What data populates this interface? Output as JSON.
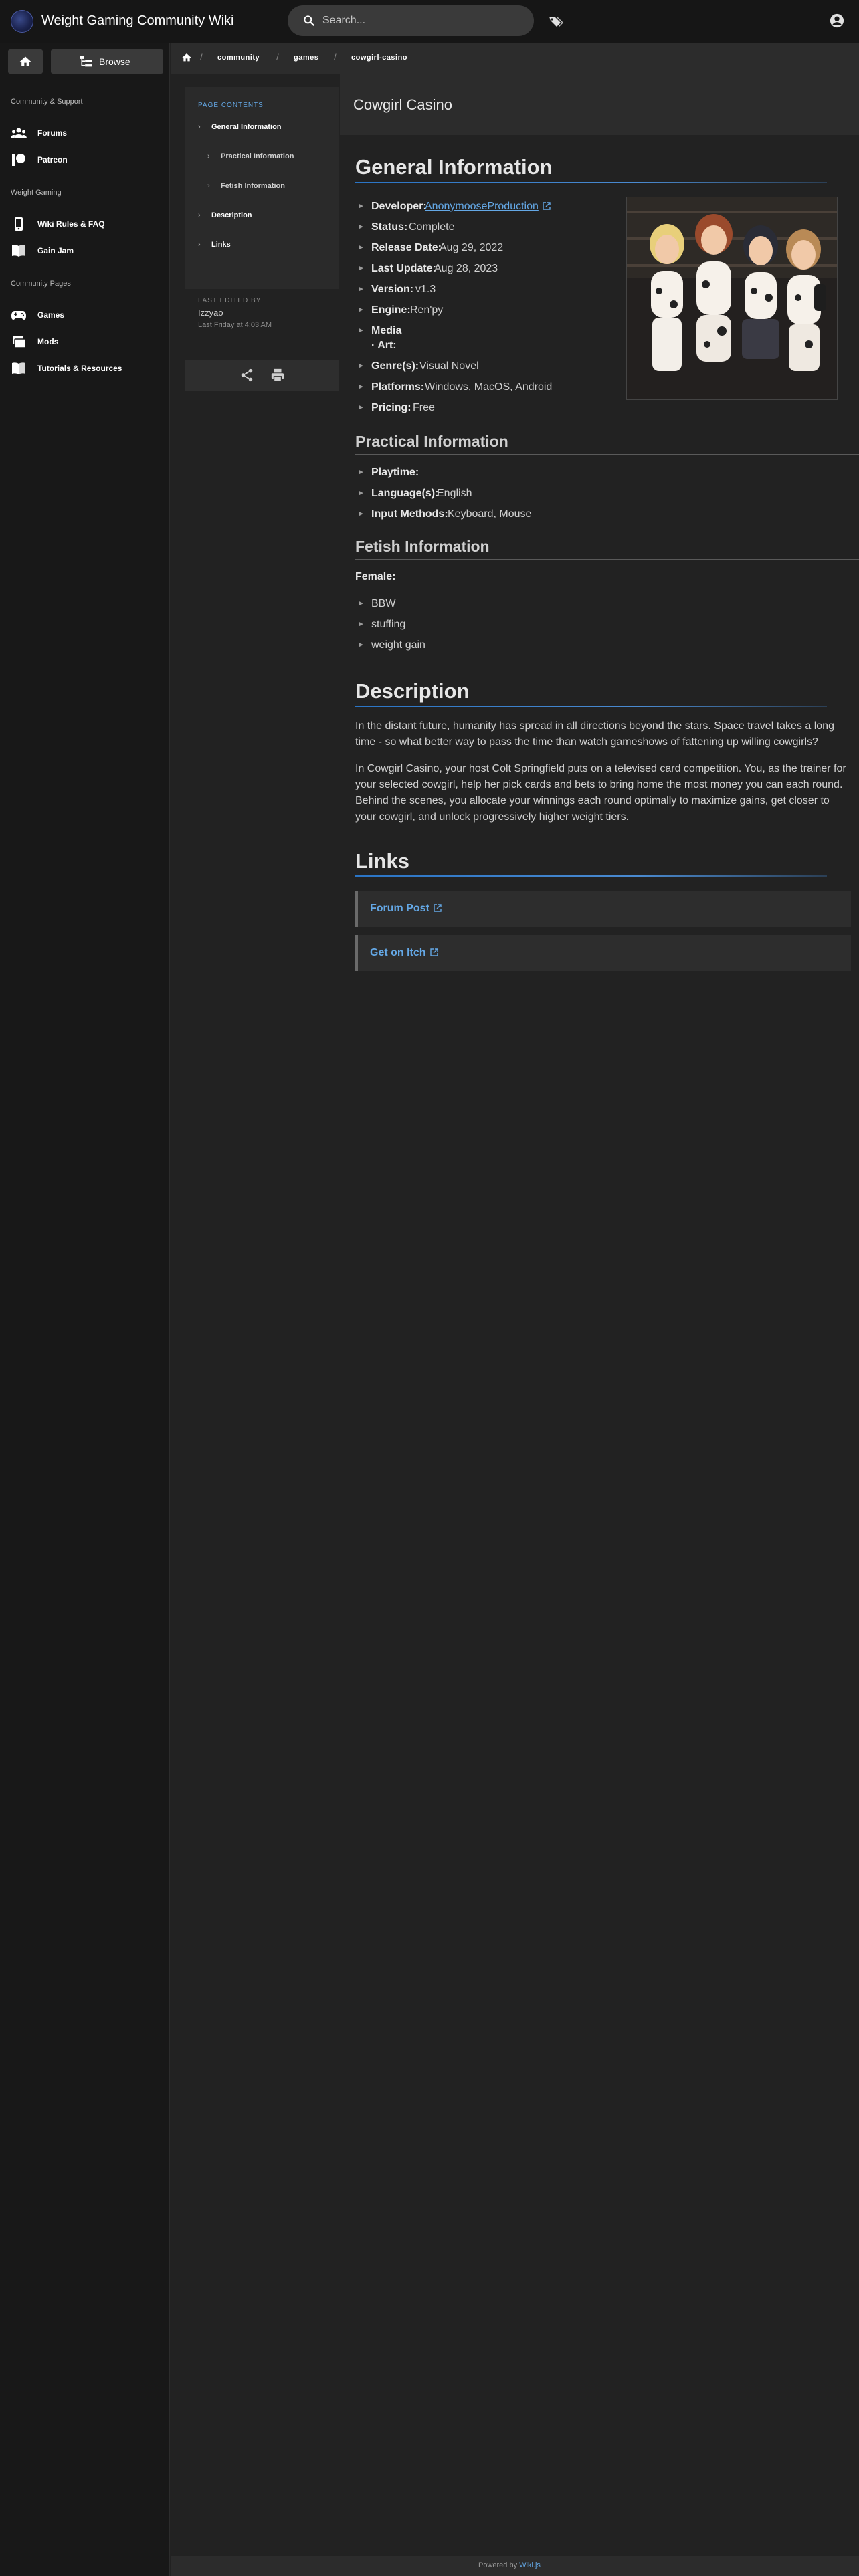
{
  "header": {
    "site_title": "Weight Gaming Community Wiki",
    "search_placeholder": "Search..."
  },
  "sidebar": {
    "browse_label": "Browse",
    "community_header": "Community & Support",
    "forums": "Forums",
    "patreon": "Patreon",
    "weight_gaming_header": "Weight Gaming",
    "wiki_rules": "Wiki Rules & FAQ",
    "gain_jam": "Gain Jam",
    "community_pages_header": "Community Pages",
    "games": "Games",
    "mods": "Mods",
    "tutorials": "Tutorials & Resources"
  },
  "breadcrumb": {
    "items": [
      "community",
      "games",
      "cowgirl-casino"
    ]
  },
  "toc": {
    "header": "PAGE CONTENTS",
    "items": [
      "General Information",
      "Practical Information",
      "Fetish Information",
      "Description",
      "Links"
    ],
    "edited_label": "LAST EDITED BY",
    "edited_user": "Izzyao",
    "edited_time": "Last Friday at 4:03 AM"
  },
  "page": {
    "title": "Cowgirl Casino",
    "general": {
      "heading": "General Information",
      "developer_k": "Developer:",
      "developer_v": "AnonymooseProduction",
      "status_k": "Status:",
      "status_v": "Complete",
      "release_k": "Release Date:",
      "release_v": "Aug 29, 2022",
      "update_k": "Last Update:",
      "update_v": "Aug 28, 2023",
      "version_k": "Version:",
      "version_v": "v1.3",
      "engine_k": "Engine:",
      "engine_v": "Ren'py",
      "media_k": "Media",
      "art_k": "Art:",
      "genre_k": "Genre(s):",
      "genre_v": "Visual Novel",
      "platforms_k": "Platforms:",
      "platforms_v": "Windows, MacOS, Android",
      "pricing_k": "Pricing:",
      "pricing_v": "Free"
    },
    "practical": {
      "heading": "Practical Information",
      "playtime_k": "Playtime:",
      "language_k": "Language(s):",
      "language_v": "English",
      "input_k": "Input Methods:",
      "input_v": "Keyboard, Mouse"
    },
    "fetish": {
      "heading": "Fetish Information",
      "female_label": "Female:",
      "items": [
        "BBW",
        "stuffing",
        "weight gain"
      ]
    },
    "description": {
      "heading": "Description",
      "p1": "In the distant future, humanity has spread in all directions beyond the stars. Space travel takes a long time - so what better way to pass the time than watch gameshows of fattening up willing cowgirls?",
      "p2": "In Cowgirl Casino, your host Colt Springfield puts on a televised card competition. You, as the trainer for your selected cowgirl, help her pick cards and bets to bring home the most money you can each round. Behind the scenes, you allocate your winnings each round optimally to maximize gains, get closer to your cowgirl, and unlock progressively higher weight tiers."
    },
    "links": {
      "heading": "Links",
      "items": [
        "Forum Post",
        "Get on Itch"
      ]
    }
  },
  "footer": {
    "powered_by": "Powered by",
    "link": "Wiki.js"
  },
  "colors": {
    "accent": "#64a8e6",
    "background": "#222222",
    "topbar": "#161616",
    "sidebar": "#181818"
  }
}
